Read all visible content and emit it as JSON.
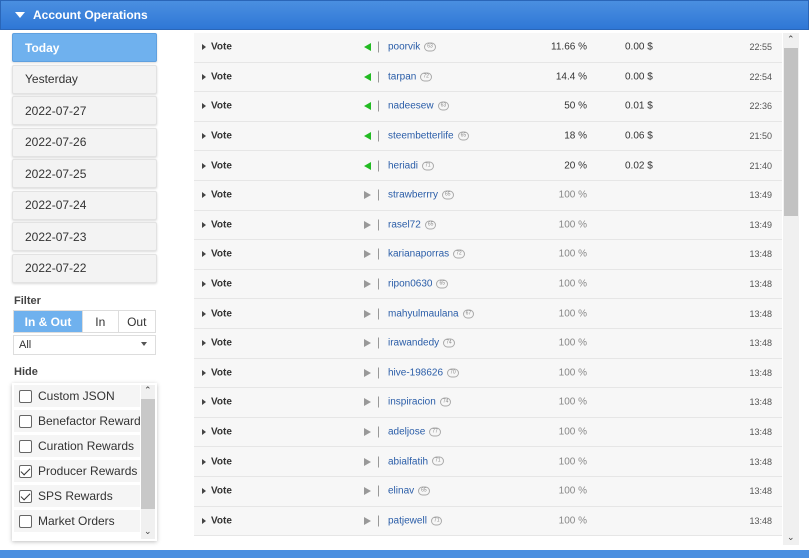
{
  "header": {
    "title": "Account Operations"
  },
  "dates": [
    {
      "label": "Today",
      "active": true
    },
    {
      "label": "Yesterday",
      "active": false
    },
    {
      "label": "2022-07-27",
      "active": false
    },
    {
      "label": "2022-07-26",
      "active": false
    },
    {
      "label": "2022-07-25",
      "active": false
    },
    {
      "label": "2022-07-24",
      "active": false
    },
    {
      "label": "2022-07-23",
      "active": false
    },
    {
      "label": "2022-07-22",
      "active": false
    }
  ],
  "filter": {
    "label": "Filter",
    "options": [
      "In & Out",
      "In",
      "Out"
    ],
    "selected": "In & Out",
    "select_value": "All"
  },
  "hide": {
    "label": "Hide",
    "items": [
      {
        "label": "Custom JSON",
        "checked": false
      },
      {
        "label": "Benefactor Rewards",
        "checked": false
      },
      {
        "label": "Curation Rewards",
        "checked": false
      },
      {
        "label": "Producer Rewards",
        "checked": true
      },
      {
        "label": "SPS Rewards",
        "checked": true
      },
      {
        "label": "Market Orders",
        "checked": false
      }
    ]
  },
  "operations": [
    {
      "type": "Vote",
      "direction": "out",
      "user": "poorvik",
      "rep": "63",
      "percent": "11.66 %",
      "amount": "0.00 $",
      "time": "22:55"
    },
    {
      "type": "Vote",
      "direction": "out",
      "user": "tarpan",
      "rep": "72",
      "percent": "14.4 %",
      "amount": "0.00 $",
      "time": "22:54"
    },
    {
      "type": "Vote",
      "direction": "out",
      "user": "nadeesew",
      "rep": "63",
      "percent": "50 %",
      "amount": "0.01 $",
      "time": "22:36"
    },
    {
      "type": "Vote",
      "direction": "out",
      "user": "steembetterlife",
      "rep": "65",
      "percent": "18 %",
      "amount": "0.06 $",
      "time": "21:50"
    },
    {
      "type": "Vote",
      "direction": "out",
      "user": "heriadi",
      "rep": "71",
      "percent": "20 %",
      "amount": "0.02 $",
      "time": "21:40"
    },
    {
      "type": "Vote",
      "direction": "in",
      "user": "strawberrry",
      "rep": "65",
      "percent": "100 %",
      "amount": "",
      "time": "13:49"
    },
    {
      "type": "Vote",
      "direction": "in",
      "user": "rasel72",
      "rep": "65",
      "percent": "100 %",
      "amount": "",
      "time": "13:49"
    },
    {
      "type": "Vote",
      "direction": "in",
      "user": "karianaporras",
      "rep": "72",
      "percent": "100 %",
      "amount": "",
      "time": "13:48"
    },
    {
      "type": "Vote",
      "direction": "in",
      "user": "ripon0630",
      "rep": "65",
      "percent": "100 %",
      "amount": "",
      "time": "13:48"
    },
    {
      "type": "Vote",
      "direction": "in",
      "user": "mahyulmaulana",
      "rep": "67",
      "percent": "100 %",
      "amount": "",
      "time": "13:48"
    },
    {
      "type": "Vote",
      "direction": "in",
      "user": "irawandedy",
      "rep": "74",
      "percent": "100 %",
      "amount": "",
      "time": "13:48"
    },
    {
      "type": "Vote",
      "direction": "in",
      "user": "hive-198626",
      "rep": "70",
      "percent": "100 %",
      "amount": "",
      "time": "13:48"
    },
    {
      "type": "Vote",
      "direction": "in",
      "user": "inspiracion",
      "rep": "74",
      "percent": "100 %",
      "amount": "",
      "time": "13:48"
    },
    {
      "type": "Vote",
      "direction": "in",
      "user": "adeljose",
      "rep": "77",
      "percent": "100 %",
      "amount": "",
      "time": "13:48"
    },
    {
      "type": "Vote",
      "direction": "in",
      "user": "abialfatih",
      "rep": "71",
      "percent": "100 %",
      "amount": "",
      "time": "13:48"
    },
    {
      "type": "Vote",
      "direction": "in",
      "user": "elinav",
      "rep": "65",
      "percent": "100 %",
      "amount": "",
      "time": "13:48"
    },
    {
      "type": "Vote",
      "direction": "in",
      "user": "patjewell",
      "rep": "71",
      "percent": "100 %",
      "amount": "",
      "time": "13:48"
    }
  ],
  "colors": {
    "header": "#2f77d6",
    "active": "#6fb1ee",
    "vote_out": "#22bb22",
    "vote_in": "#999999",
    "link": "#2a5da8"
  }
}
